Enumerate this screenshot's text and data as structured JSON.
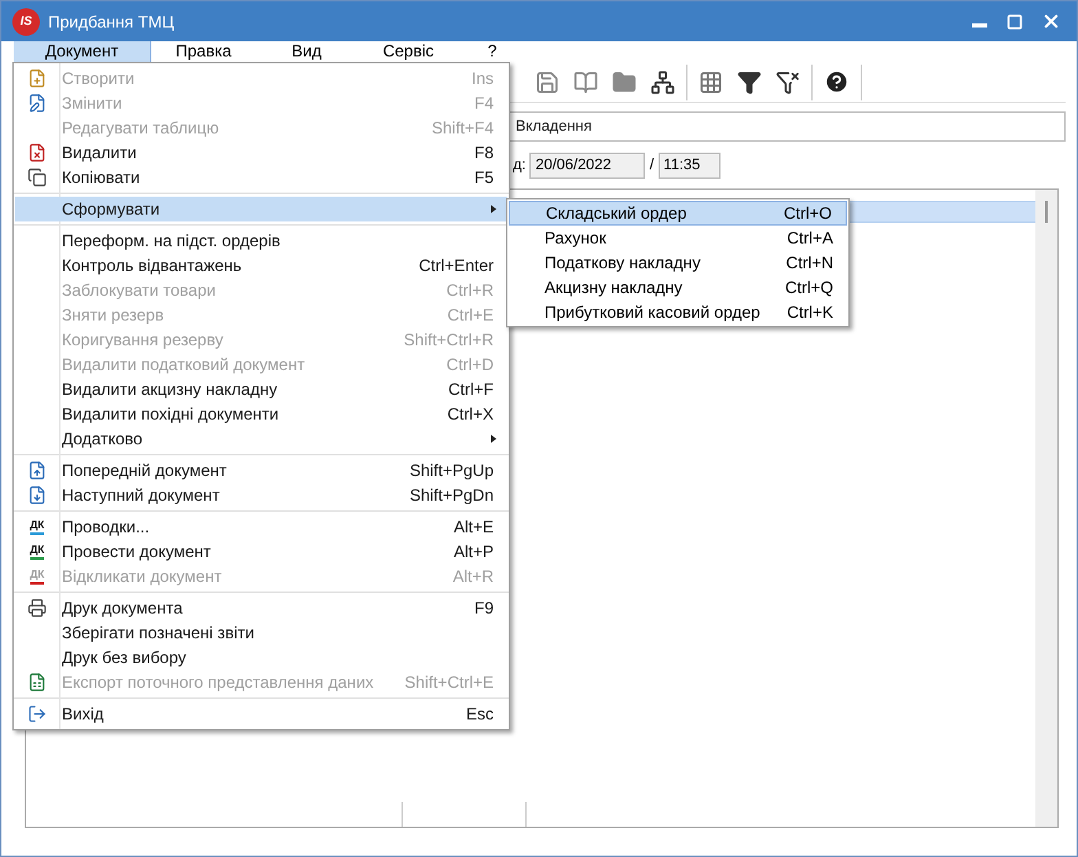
{
  "window": {
    "title": "Придбання ТМЦ",
    "logo_text": "IS"
  },
  "menubar": [
    {
      "label": "Документ",
      "selected": true
    },
    {
      "label": "Правка",
      "selected": false
    },
    {
      "label": "Вид",
      "selected": false
    },
    {
      "label": "Сервіс",
      "selected": false
    },
    {
      "label": "?",
      "selected": false
    }
  ],
  "menu": {
    "groups": [
      [
        {
          "label": "Створити",
          "shortcut": "Ins",
          "disabled": true
        },
        {
          "label": "Змінити",
          "shortcut": "F4",
          "disabled": true
        },
        {
          "label": "Редагувати таблицю",
          "shortcut": "Shift+F4",
          "disabled": true
        },
        {
          "label": "Видалити",
          "shortcut": "F8",
          "disabled": false
        },
        {
          "label": "Копіювати",
          "shortcut": "F5",
          "disabled": false
        }
      ],
      [
        {
          "label": "Сформувати",
          "disabled": false,
          "submenu": true,
          "selected": true
        }
      ],
      [
        {
          "label": "Переформ. на підст. ордерів",
          "disabled": false
        },
        {
          "label": "Контроль відвантажень",
          "shortcut": "Ctrl+Enter",
          "disabled": false
        },
        {
          "label": "Заблокувати товари",
          "shortcut": "Ctrl+R",
          "disabled": true
        },
        {
          "label": "Зняти резерв",
          "shortcut": "Ctrl+E",
          "disabled": true
        },
        {
          "label": "Коригування резерву",
          "shortcut": "Shift+Ctrl+R",
          "disabled": true
        },
        {
          "label": "Видалити податковий документ",
          "shortcut": "Ctrl+D",
          "disabled": true
        },
        {
          "label": "Видалити акцизну накладну",
          "shortcut": "Ctrl+F",
          "disabled": false
        },
        {
          "label": "Видалити похідні документи",
          "shortcut": "Ctrl+X",
          "disabled": false
        },
        {
          "label": "Додатково",
          "disabled": false,
          "submenu": true,
          "selected": false
        }
      ],
      [
        {
          "label": "Попередній документ",
          "shortcut": "Shift+PgUp",
          "disabled": false
        },
        {
          "label": "Наступний документ",
          "shortcut": "Shift+PgDn",
          "disabled": false
        }
      ],
      [
        {
          "label": "Проводки...",
          "shortcut": "Alt+E",
          "disabled": false,
          "badge": "ДК"
        },
        {
          "label": "Провести документ",
          "shortcut": "Alt+P",
          "disabled": false,
          "badge": "ДК"
        },
        {
          "label": "Відкликати документ",
          "shortcut": "Alt+R",
          "disabled": true,
          "badge": "ДК"
        }
      ],
      [
        {
          "label": "Друк документа",
          "shortcut": "F9",
          "disabled": false
        },
        {
          "label": "Зберігати позначені звіти",
          "disabled": false
        },
        {
          "label": "Друк без вибору",
          "disabled": false
        },
        {
          "label": "Експорт поточного представлення даних",
          "shortcut": "Shift+Ctrl+E",
          "disabled": true
        }
      ],
      [
        {
          "label": "Вихід",
          "shortcut": "Esc",
          "disabled": false
        }
      ]
    ]
  },
  "submenu": [
    {
      "label": "Складський ордер",
      "shortcut": "Ctrl+O",
      "selected": true
    },
    {
      "label": "Рахунок",
      "shortcut": "Ctrl+A",
      "selected": false
    },
    {
      "label": "Податкову накладну",
      "shortcut": "Ctrl+N",
      "selected": false
    },
    {
      "label": "Акцизну накладну",
      "shortcut": "Ctrl+Q",
      "selected": false
    },
    {
      "label": "Прибутковий касовий ордер",
      "shortcut": "Ctrl+K",
      "selected": false
    }
  ],
  "tab": {
    "label": "Вкладення"
  },
  "date_row": {
    "label": "д:",
    "date": "20/06/2022",
    "separator": "/",
    "time": "11:35"
  }
}
